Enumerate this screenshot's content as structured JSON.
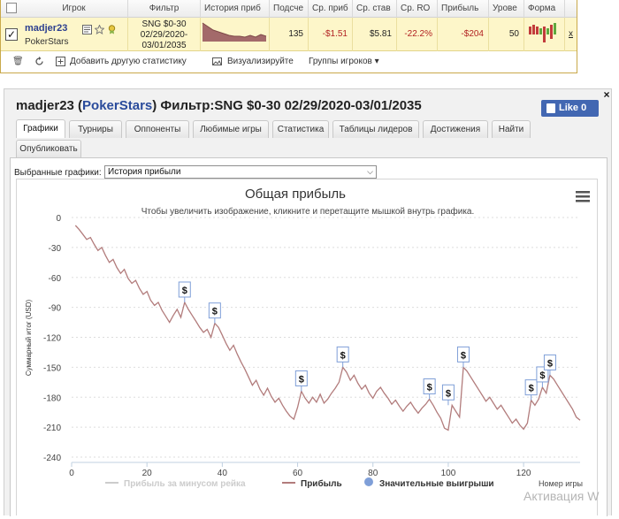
{
  "table": {
    "headers": [
      "Игрок",
      "Фильтр",
      "История приб",
      "Подсче",
      "Ср. приб",
      "Ср. став",
      "Ср. RO",
      "Прибыль",
      "Урове",
      "Форма"
    ],
    "row": {
      "player_name": "madjer23",
      "site": "PokerStars",
      "filter_lines": [
        "SNG $0-30",
        "02/29/2020-",
        "03/01/2035"
      ],
      "count": "135",
      "avg_profit": "-$1.51",
      "avg_stake": "$5.81",
      "avg_roi": "-22.2%",
      "profit": "-$204",
      "level": "50",
      "remove": "x"
    },
    "tools": {
      "add_stats": "Добавить другую статистику",
      "visualize": "Визуализируйте",
      "groups": "Группы игроков"
    }
  },
  "panel": {
    "title_name": "madjer23",
    "title_open": " (",
    "title_site": "PokerStars",
    "title_filter": ") Фильтр:SNG $0-30 02/29/2020-03/01/2035",
    "like": "Like 0",
    "close": "×",
    "tabs": [
      "Графики",
      "Турниры",
      "Оппоненты",
      "Любимые игры",
      "Статистика",
      "Таблицы лидеров",
      "Достижения",
      "Найти",
      "Опубликовать"
    ],
    "selected_chart_label": "Выбранные графики:",
    "selected_chart_value": "История прибыли"
  },
  "chart_data": {
    "type": "line",
    "title": "Общая прибыль",
    "subtitle": "Чтобы увеличить изображение, кликните и перетащите мышкой внутрь графика.",
    "ylabel": "Суммарный итог (USD)",
    "xlabel": "Номер игры",
    "xlim": [
      0,
      135
    ],
    "ylim": [
      -240,
      0
    ],
    "x_ticks": [
      0,
      20,
      40,
      60,
      80,
      100,
      120
    ],
    "y_ticks": [
      0,
      -30,
      -60,
      -90,
      -120,
      -150,
      -180,
      -210,
      -240
    ],
    "legend": [
      "Прибыль за минусом рейка",
      "Прибыль",
      "Значительные выигрыши"
    ],
    "legend_position": "bottom",
    "grid": true,
    "colors": {
      "profit": "#b27c7c",
      "rakeless": "#cccccc",
      "bigwin": "#7f9fd8"
    },
    "big_win_marker": "$",
    "series": [
      {
        "name": "Прибыль",
        "values": [
          [
            1,
            -8
          ],
          [
            2,
            -12
          ],
          [
            3,
            -17
          ],
          [
            4,
            -22
          ],
          [
            5,
            -20
          ],
          [
            6,
            -27
          ],
          [
            7,
            -33
          ],
          [
            8,
            -30
          ],
          [
            9,
            -38
          ],
          [
            10,
            -45
          ],
          [
            11,
            -42
          ],
          [
            12,
            -50
          ],
          [
            13,
            -56
          ],
          [
            14,
            -52
          ],
          [
            15,
            -61
          ],
          [
            16,
            -66
          ],
          [
            17,
            -63
          ],
          [
            18,
            -71
          ],
          [
            19,
            -77
          ],
          [
            20,
            -74
          ],
          [
            21,
            -83
          ],
          [
            22,
            -88
          ],
          [
            23,
            -85
          ],
          [
            24,
            -93
          ],
          [
            25,
            -99
          ],
          [
            26,
            -105
          ],
          [
            27,
            -98
          ],
          [
            28,
            -92
          ],
          [
            29,
            -100
          ],
          [
            30,
            -85
          ],
          [
            31,
            -92
          ],
          [
            32,
            -98
          ],
          [
            33,
            -104
          ],
          [
            34,
            -110
          ],
          [
            35,
            -115
          ],
          [
            36,
            -112
          ],
          [
            37,
            -120
          ],
          [
            38,
            -106
          ],
          [
            39,
            -110
          ],
          [
            40,
            -118
          ],
          [
            41,
            -126
          ],
          [
            42,
            -133
          ],
          [
            43,
            -128
          ],
          [
            44,
            -137
          ],
          [
            45,
            -145
          ],
          [
            46,
            -152
          ],
          [
            47,
            -160
          ],
          [
            48,
            -168
          ],
          [
            49,
            -163
          ],
          [
            50,
            -172
          ],
          [
            51,
            -178
          ],
          [
            52,
            -171
          ],
          [
            53,
            -179
          ],
          [
            54,
            -185
          ],
          [
            55,
            -181
          ],
          [
            56,
            -188
          ],
          [
            57,
            -194
          ],
          [
            58,
            -199
          ],
          [
            59,
            -202
          ],
          [
            60,
            -190
          ],
          [
            61,
            -174
          ],
          [
            62,
            -181
          ],
          [
            63,
            -186
          ],
          [
            64,
            -180
          ],
          [
            65,
            -185
          ],
          [
            66,
            -177
          ],
          [
            67,
            -186
          ],
          [
            68,
            -182
          ],
          [
            69,
            -176
          ],
          [
            70,
            -171
          ],
          [
            71,
            -165
          ],
          [
            72,
            -150
          ],
          [
            73,
            -155
          ],
          [
            74,
            -163
          ],
          [
            75,
            -158
          ],
          [
            76,
            -166
          ],
          [
            77,
            -172
          ],
          [
            78,
            -168
          ],
          [
            79,
            -176
          ],
          [
            80,
            -181
          ],
          [
            81,
            -174
          ],
          [
            82,
            -170
          ],
          [
            83,
            -176
          ],
          [
            84,
            -181
          ],
          [
            85,
            -187
          ],
          [
            86,
            -183
          ],
          [
            87,
            -189
          ],
          [
            88,
            -194
          ],
          [
            89,
            -189
          ],
          [
            90,
            -185
          ],
          [
            91,
            -191
          ],
          [
            92,
            -196
          ],
          [
            93,
            -191
          ],
          [
            94,
            -187
          ],
          [
            95,
            -182
          ],
          [
            96,
            -188
          ],
          [
            97,
            -195
          ],
          [
            98,
            -201
          ],
          [
            99,
            -211
          ],
          [
            100,
            -213
          ],
          [
            101,
            -188
          ],
          [
            102,
            -194
          ],
          [
            103,
            -200
          ],
          [
            104,
            -150
          ],
          [
            105,
            -154
          ],
          [
            106,
            -160
          ],
          [
            107,
            -166
          ],
          [
            108,
            -172
          ],
          [
            109,
            -178
          ],
          [
            110,
            -184
          ],
          [
            111,
            -180
          ],
          [
            112,
            -186
          ],
          [
            113,
            -192
          ],
          [
            114,
            -188
          ],
          [
            115,
            -194
          ],
          [
            116,
            -200
          ],
          [
            117,
            -206
          ],
          [
            118,
            -202
          ],
          [
            119,
            -208
          ],
          [
            120,
            -212
          ],
          [
            121,
            -206
          ],
          [
            122,
            -183
          ],
          [
            123,
            -188
          ],
          [
            124,
            -182
          ],
          [
            125,
            -170
          ],
          [
            126,
            -176
          ],
          [
            127,
            -158
          ],
          [
            128,
            -162
          ],
          [
            129,
            -168
          ],
          [
            130,
            -174
          ],
          [
            131,
            -180
          ],
          [
            132,
            -186
          ],
          [
            133,
            -192
          ],
          [
            134,
            -200
          ],
          [
            135,
            -203
          ]
        ]
      }
    ],
    "big_wins": [
      [
        30,
        -85
      ],
      [
        38,
        -106
      ],
      [
        61,
        -174
      ],
      [
        72,
        -150
      ],
      [
        95,
        -182
      ],
      [
        100,
        -188
      ],
      [
        104,
        -150
      ],
      [
        122,
        -183
      ],
      [
        125,
        -170
      ],
      [
        127,
        -158
      ]
    ]
  },
  "watermark": "Активация W"
}
